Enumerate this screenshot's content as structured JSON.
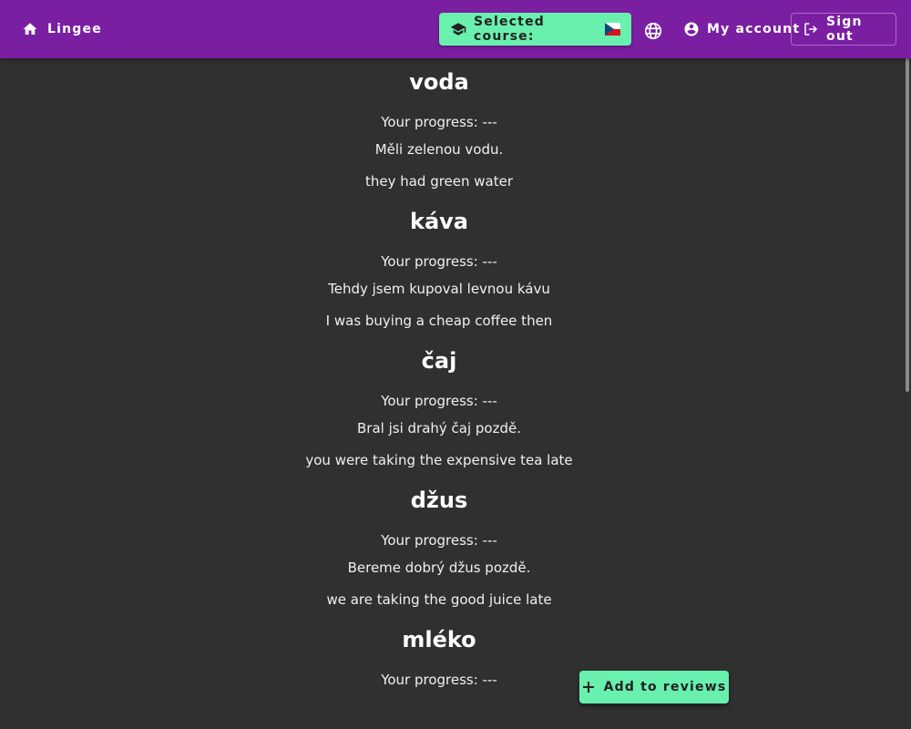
{
  "header": {
    "home_label": "Lingee",
    "course_label": "Selected course:",
    "course_flag": "czech-flag",
    "language_icon": "globe-icon",
    "account_label": "My account",
    "signout_label": "Sign out"
  },
  "colors": {
    "appbar": "#7b1fa2",
    "accent": "#69f0ae",
    "background": "#303030"
  },
  "words": [
    {
      "word": "voda",
      "progress": "Your progress: ---",
      "sentence": "Měli zelenou vodu.",
      "translation": "they had green water"
    },
    {
      "word": "káva",
      "progress": "Your progress: ---",
      "sentence": "Tehdy jsem kupoval levnou kávu",
      "translation": "I was buying a cheap coffee then"
    },
    {
      "word": "čaj",
      "progress": "Your progress: ---",
      "sentence": "Bral jsi drahý čaj pozdě.",
      "translation": "you were taking the expensive tea late"
    },
    {
      "word": "džus",
      "progress": "Your progress: ---",
      "sentence": "Bereme dobrý džus pozdě.",
      "translation": "we are taking the good juice late"
    },
    {
      "word": "mléko",
      "progress": "Your progress: ---"
    }
  ],
  "fab": {
    "label": "Add to reviews"
  }
}
